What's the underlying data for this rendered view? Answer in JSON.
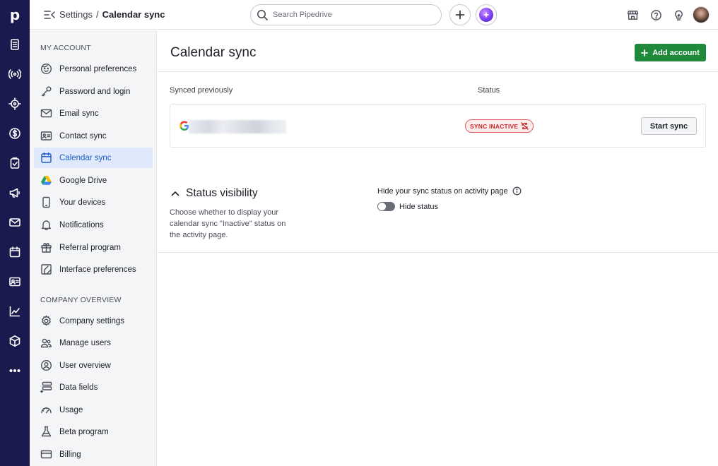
{
  "app": {
    "logo_letter": "p"
  },
  "breadcrumb": {
    "parent": "Settings",
    "separator": "/",
    "current": "Calendar sync"
  },
  "search": {
    "placeholder": "Search Pipedrive",
    "value": ""
  },
  "sidebar": {
    "my_account_title": "MY ACCOUNT",
    "my_account": [
      {
        "label": "Personal preferences",
        "icon": "face-icon"
      },
      {
        "label": "Password and login",
        "icon": "key-icon"
      },
      {
        "label": "Email sync",
        "icon": "envelope-icon"
      },
      {
        "label": "Contact sync",
        "icon": "contact-card-icon"
      },
      {
        "label": "Calendar sync",
        "icon": "calendar-icon",
        "active": true
      },
      {
        "label": "Google Drive",
        "icon": "google-drive-icon"
      },
      {
        "label": "Your devices",
        "icon": "phone-icon"
      },
      {
        "label": "Notifications",
        "icon": "bell-icon"
      },
      {
        "label": "Referral program",
        "icon": "gift-icon"
      },
      {
        "label": "Interface preferences",
        "icon": "interface-icon"
      }
    ],
    "company_title": "COMPANY OVERVIEW",
    "company": [
      {
        "label": "Company settings",
        "icon": "gear-icon"
      },
      {
        "label": "Manage users",
        "icon": "users-icon"
      },
      {
        "label": "User overview",
        "icon": "user-circle-icon"
      },
      {
        "label": "Data fields",
        "icon": "data-fields-icon"
      },
      {
        "label": "Usage",
        "icon": "gauge-icon"
      },
      {
        "label": "Beta program",
        "icon": "flask-icon"
      },
      {
        "label": "Billing",
        "icon": "credit-card-icon"
      }
    ]
  },
  "main": {
    "title": "Calendar sync",
    "add_account_label": "Add account",
    "col_synced": "Synced previously",
    "col_status": "Status",
    "account": {
      "provider": "google",
      "status_badge": "SYNC INACTIVE",
      "action_label": "Start sync"
    },
    "visibility": {
      "title": "Status visibility",
      "description": "Choose whether to display your calendar sync \"Inactive\" status on the activity page.",
      "option_label": "Hide your sync status on activity page",
      "toggle_label": "Hide status",
      "toggle_on": false
    }
  },
  "colors": {
    "rail": "#1b1a4f",
    "primary_green": "#1f8a3b",
    "active_blue": "#1a5cc8",
    "inactive_red": "#c62828"
  }
}
